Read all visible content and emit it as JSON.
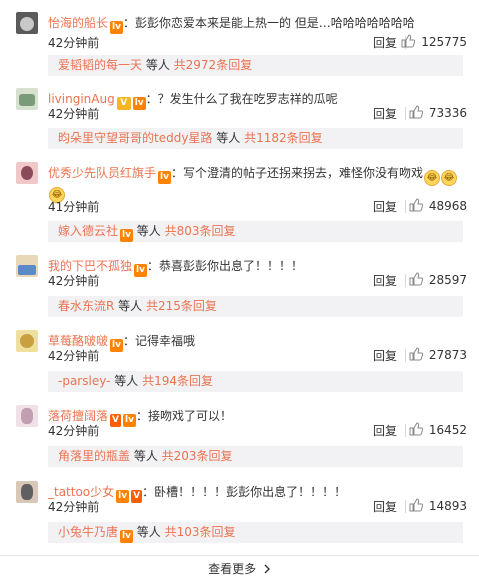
{
  "comments": [
    {
      "user": "怡海的船长",
      "badges": [
        "lv"
      ],
      "badge_texts": [
        "lv"
      ],
      "text": "：彭彭你恋爱本来是能上热一的 但是…哈哈哈哈哈哈哈",
      "time": "42分钟前",
      "reply": "回复",
      "likes": "125775",
      "sub_user": "爱韬韬的每一天",
      "sub_mid": " 等人 ",
      "sub_total": "共2972条回复",
      "avatar_colors": [
        "#5a5a5a",
        "#c8c8c8"
      ]
    },
    {
      "user": "livinginAug",
      "badges": [
        "v",
        "lv"
      ],
      "badge_texts": [
        "V",
        "lv"
      ],
      "text": "：？发生什么了我在吃罗志祥的瓜呢",
      "time": "42分钟前",
      "reply": "回复",
      "likes": "73336",
      "sub_user": "昀朵里守望哥哥的teddy星路",
      "sub_mid": " 等人 ",
      "sub_total": "共1182条回复",
      "avatar_colors": [
        "#7a9a7a",
        "#d8e0d0"
      ]
    },
    {
      "user": "优秀少先队员红旗手",
      "badges": [
        "lv"
      ],
      "badge_texts": [
        "lv"
      ],
      "text": "：写个澄清的帖子还拐来拐去，难怪你没有吻戏",
      "time": "41分钟前",
      "reply": "回复",
      "likes": "48968",
      "sub_user": "嫁入德云社",
      "sub_mid": " 等人 ",
      "sub_total": "共803条回复",
      "avatar_colors": [
        "#8a4a5a",
        "#f0c8c8"
      ]
    },
    {
      "user": "我的下巴不孤独",
      "badges": [
        "lv"
      ],
      "badge_texts": [
        "lv"
      ],
      "text": "：恭喜彭彭你出息了！！！！",
      "time": "42分钟前",
      "reply": "回复",
      "likes": "28597",
      "sub_user": "春水东流R",
      "sub_mid": " 等人 ",
      "sub_total": "共215条回复",
      "avatar_colors": [
        "#5a8ac8",
        "#e8d8b8"
      ]
    },
    {
      "user": "草莓酪啵啵",
      "badges": [
        "lv"
      ],
      "badge_texts": [
        "lv"
      ],
      "text": "：记得幸福哦",
      "time": "42分钟前",
      "reply": "回复",
      "likes": "27873",
      "sub_user": "-parsley-",
      "sub_mid": " 等人 ",
      "sub_total": "共194条回复",
      "avatar_colors": [
        "#c8a040",
        "#f0e0a0"
      ]
    },
    {
      "user": "落荷擅阔落",
      "badges": [
        "vip",
        "lv"
      ],
      "badge_texts": [
        "V",
        "lv"
      ],
      "text": "：接吻戏了可以！",
      "time": "42分钟前",
      "reply": "回复",
      "likes": "16452",
      "sub_user": "角落里的瓶盖",
      "sub_mid": " 等人 ",
      "sub_total": "共203条回复",
      "avatar_colors": [
        "#c0a0b0",
        "#f0e0e8"
      ]
    },
    {
      "user": "_tattoo少女",
      "badges": [
        "lv",
        "vip"
      ],
      "badge_texts": [
        "lv",
        "V"
      ],
      "text": "：卧槽！！！！彭彭你出息了！！！！",
      "time": "42分钟前",
      "reply": "回复",
      "likes": "14893",
      "sub_user": "小兔牛乃唐",
      "sub_mid": " 等人 ",
      "sub_total": "共103条回复",
      "avatar_colors": [
        "#606060",
        "#d8c8b8"
      ]
    }
  ],
  "emoji_extra": [
    "😂",
    "😂",
    "😂"
  ],
  "more_label": "查看更多",
  "more_icon": "chevron-right-icon"
}
